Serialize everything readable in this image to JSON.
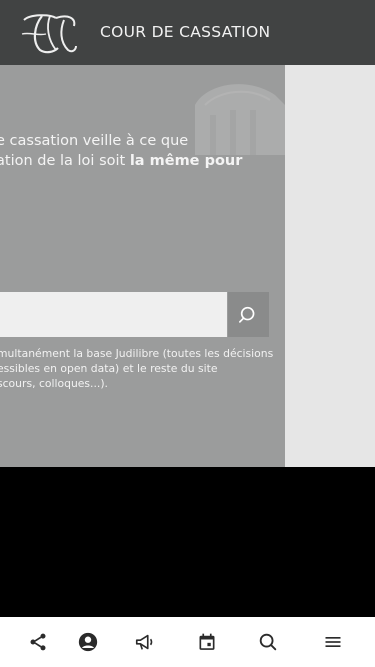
{
  "header": {
    "title": "COUR DE CASSATION",
    "logo": "cour-de-cassation-monogram"
  },
  "hero": {
    "line1": "e cassation veille à ce que",
    "line2_normal": "ation de la loi soit ",
    "line2_bold": "la même pour"
  },
  "search": {
    "placeholder": "",
    "value": "",
    "button_icon": "search-icon",
    "help_line1": "multanément la base Judilibre (toutes les décisions",
    "help_line2": "essibles en open data) et le reste du site",
    "help_line3": "scours, colloques...)."
  },
  "bottom_nav": {
    "items": [
      {
        "icon": "share-icon"
      },
      {
        "icon": "account-icon"
      },
      {
        "icon": "megaphone-icon"
      },
      {
        "icon": "calendar-icon"
      },
      {
        "icon": "search-icon"
      },
      {
        "icon": "menu-icon"
      }
    ]
  },
  "colors": {
    "header_bg": "#414343",
    "hero_bg": "#9b9c9c",
    "side_panel_bg": "#e6e6e6",
    "nav_icon": "#2b2b2b"
  }
}
